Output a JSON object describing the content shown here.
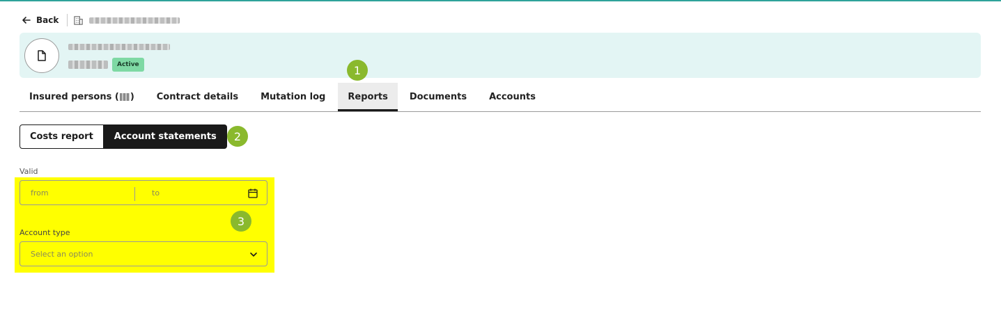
{
  "breadcrumb": {
    "back_label": "Back",
    "back_icon": "arrow-left-icon",
    "building_icon": "building-icon"
  },
  "header": {
    "doc_icon": "document-icon",
    "status_badge": "Active",
    "background_color": "#e3f5f4"
  },
  "tabs": [
    {
      "label_prefix": "Insured persons (",
      "label_suffix": ")"
    },
    {
      "label": "Contract details"
    },
    {
      "label": "Mutation log"
    },
    {
      "label": "Reports",
      "active": true
    },
    {
      "label": "Documents"
    },
    {
      "label": "Accounts"
    }
  ],
  "markers": [
    "1",
    "2",
    "3"
  ],
  "report_switch": {
    "costs_label": "Costs report",
    "statements_label": "Account statements",
    "selected": "Account statements"
  },
  "filters": {
    "valid_label": "Valid",
    "from_placeholder": "from",
    "to_placeholder": "to",
    "calendar_icon": "calendar-icon",
    "account_type_label": "Account type",
    "account_type_placeholder": "Select an option",
    "chevron_icon": "chevron-down-icon",
    "highlight_color": "#ffff00"
  },
  "colors": {
    "accent_teal": "#2fa39a",
    "marker_green": "#8ab92d",
    "badge_green": "#7ed9a4"
  }
}
